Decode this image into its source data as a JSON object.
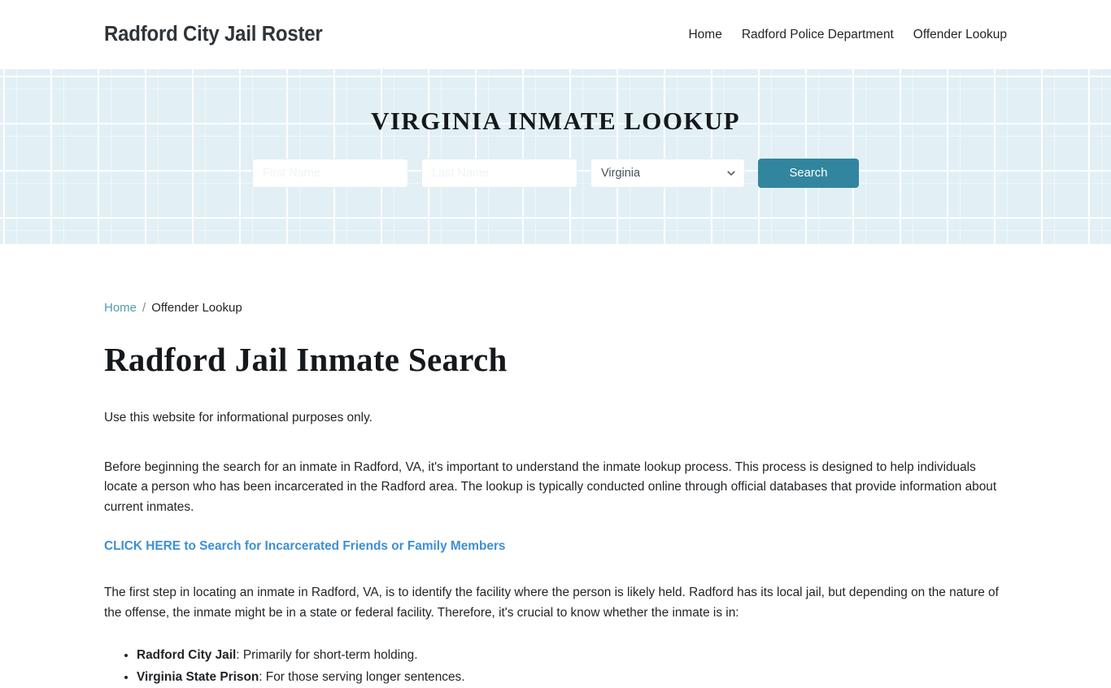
{
  "header": {
    "brand": "Radford City Jail Roster",
    "nav": [
      {
        "label": "Home"
      },
      {
        "label": "Radford Police Department"
      },
      {
        "label": "Offender Lookup"
      }
    ]
  },
  "hero": {
    "title": "VIRGINIA INMATE LOOKUP",
    "first_name_placeholder": "First Name",
    "first_name_value": "",
    "last_name_placeholder": "Last Name",
    "last_name_value": "",
    "state_selected": "Virginia",
    "state_options": [
      "Virginia"
    ],
    "search_label": "Search",
    "accent_color": "#31859f",
    "background_color": "#e2f0f5"
  },
  "breadcrumb": {
    "home": "Home",
    "separator": "/",
    "current": "Offender Lookup"
  },
  "main": {
    "page_title": "Radford Jail Inmate Search",
    "intro": "Use this website for informational purposes only.",
    "paragraph_1": "Before beginning the search for an inmate in Radford, VA, it's important to understand the inmate lookup process. This process is designed to help individuals locate a person who has been incarcerated in the Radford area. The lookup is typically conducted online through official databases that provide information about current inmates.",
    "cta_link": "CLICK HERE to Search for Incarcerated Friends or Family Members",
    "cta_color": "#3d8fd4",
    "paragraph_2": "The first step in locating an inmate in Radford, VA, is to identify the facility where the person is likely held. Radford has its local jail, but depending on the nature of the offense, the inmate might be in a state or federal facility. Therefore, it's crucial to know whether the inmate is in:",
    "facility_list": [
      {
        "term": "Radford City Jail",
        "description": ": Primarily for short-term holding."
      },
      {
        "term": "Virginia State Prison",
        "description": ": For those serving longer sentences."
      }
    ]
  }
}
